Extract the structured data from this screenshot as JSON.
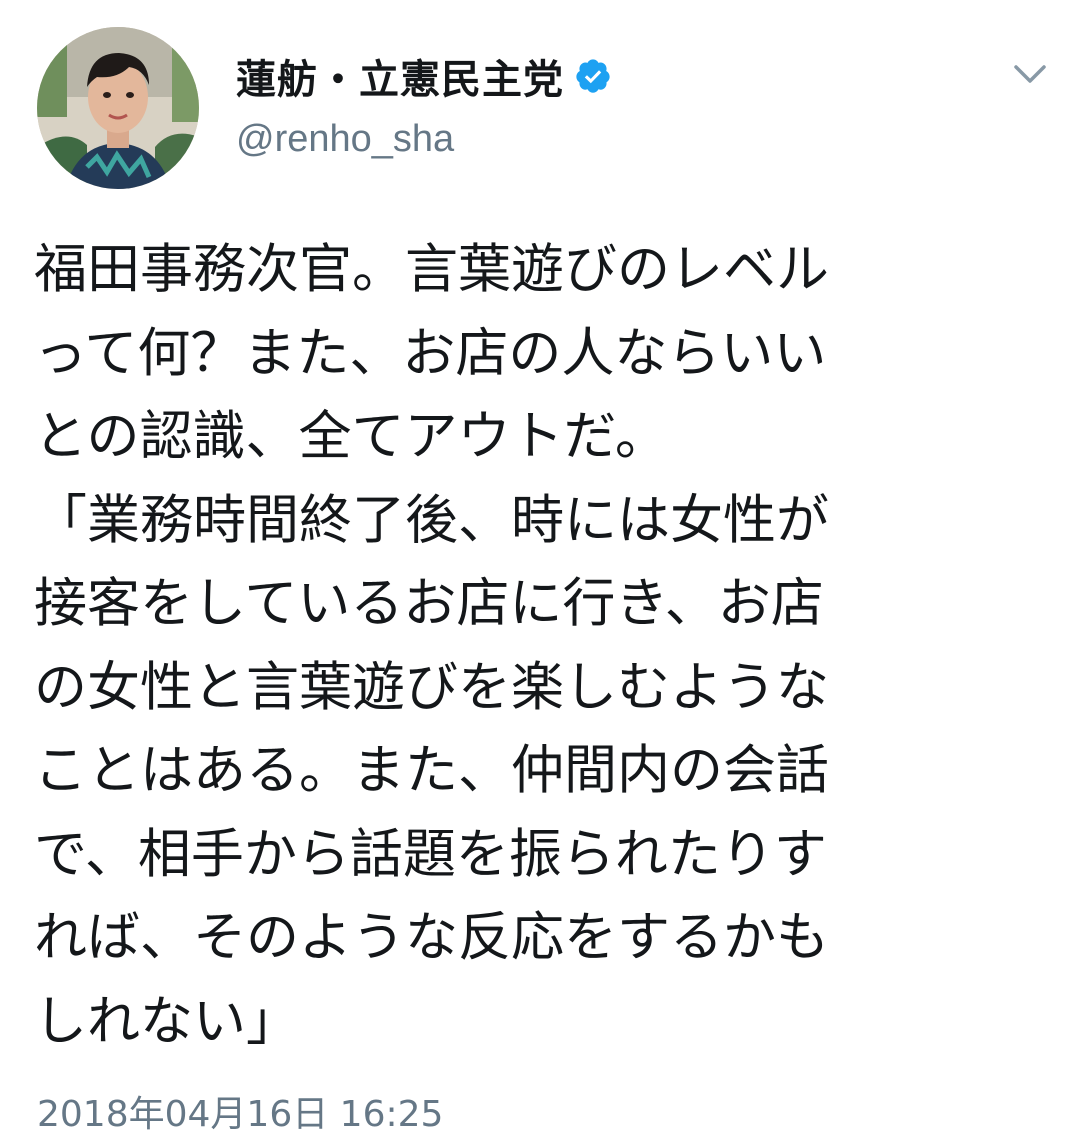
{
  "tweet": {
    "display_name": "蓮舫・立憲民主党",
    "handle": "@renho_sha",
    "verified": true,
    "text_lines": [
      "福田事務次官。言葉遊びのレベル",
      "って何？また、お店の人ならいい",
      "との認識、全てアウトだ。",
      "「業務時間終了後、時には女性が",
      "接客をしているお店に行き、お店",
      "の女性と言葉遊びを楽しむような",
      "ことはある。また、仲間内の会話",
      "で、相手から話題を振られたりす",
      "れば、そのような反応をするかも",
      "しれない」"
    ],
    "timestamp": "2018年04月16日 16:25"
  },
  "icons": {
    "verified": "verified-badge-icon",
    "menu": "chevron-down-icon"
  },
  "colors": {
    "text": "#14171a",
    "secondary": "#657786",
    "verified_blue": "#1da1f2"
  }
}
